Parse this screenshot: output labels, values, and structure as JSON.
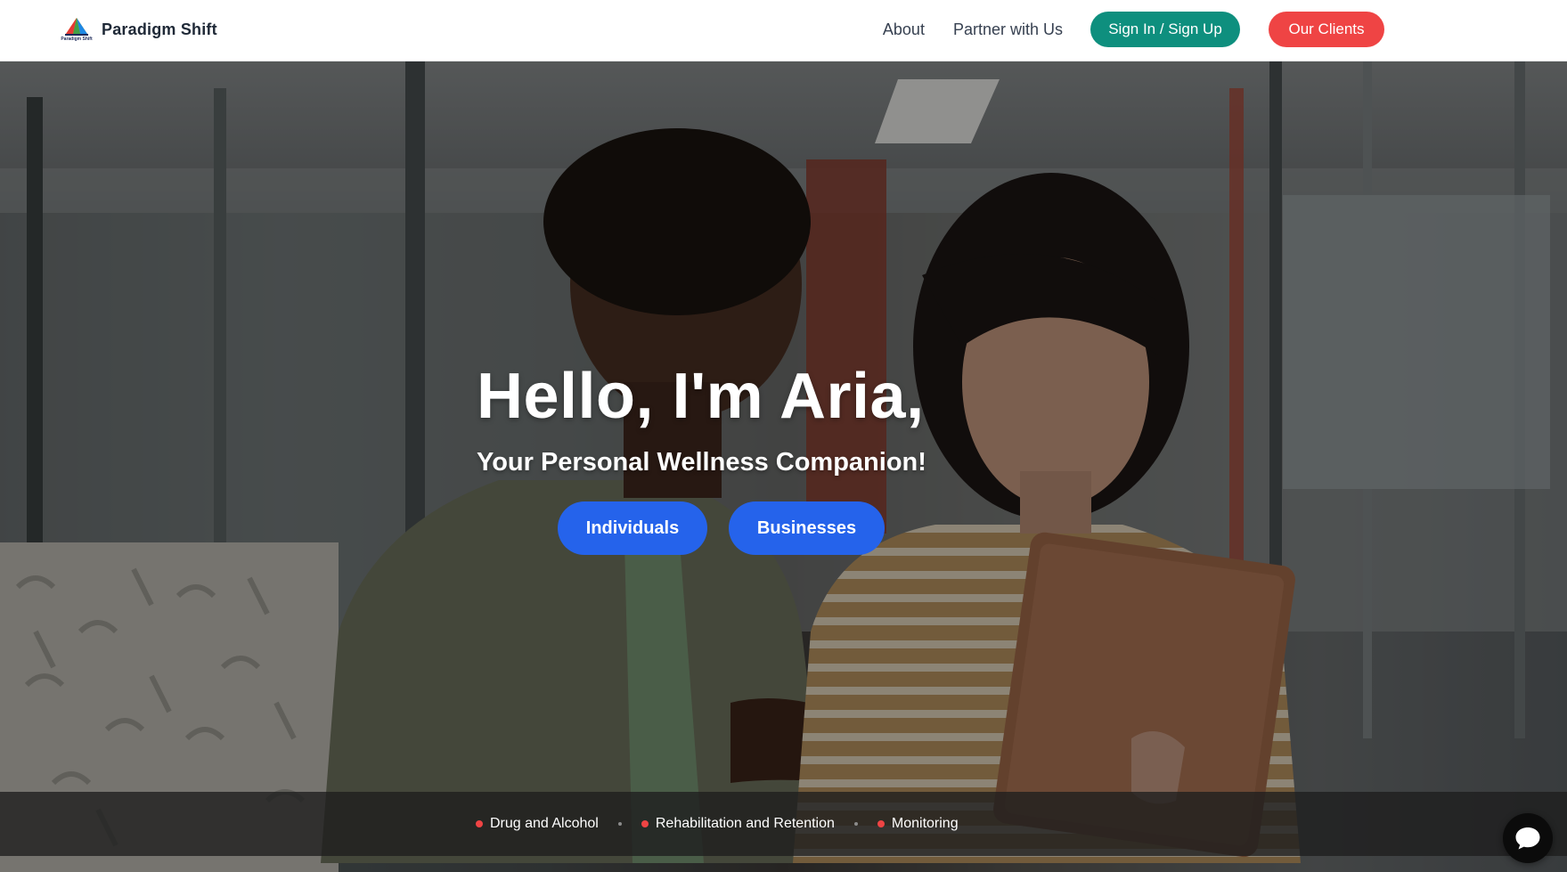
{
  "brand": {
    "name": "Paradigm Shift",
    "logo_caption": "Paradigm Shift"
  },
  "nav": {
    "about": "About",
    "partner": "Partner with Us",
    "signin": "Sign In / Sign Up",
    "clients": "Our Clients"
  },
  "hero": {
    "title": "Hello, I'm Aria,",
    "subtitle": "Your Personal Wellness Companion!",
    "buttons": {
      "individuals": "Individuals",
      "businesses": "Businesses"
    }
  },
  "services": [
    {
      "label": "Drug and Alcohol"
    },
    {
      "label": "Rehabilitation and Retention"
    },
    {
      "label": "Monitoring"
    }
  ],
  "icons": {
    "chat": "chat-bubble-icon",
    "logo": "paradigm-shift-logo"
  },
  "colors": {
    "signin": "#0e8f7e",
    "clients": "#ef4444",
    "cta": "#2563eb",
    "bullet": "#ef4444"
  }
}
